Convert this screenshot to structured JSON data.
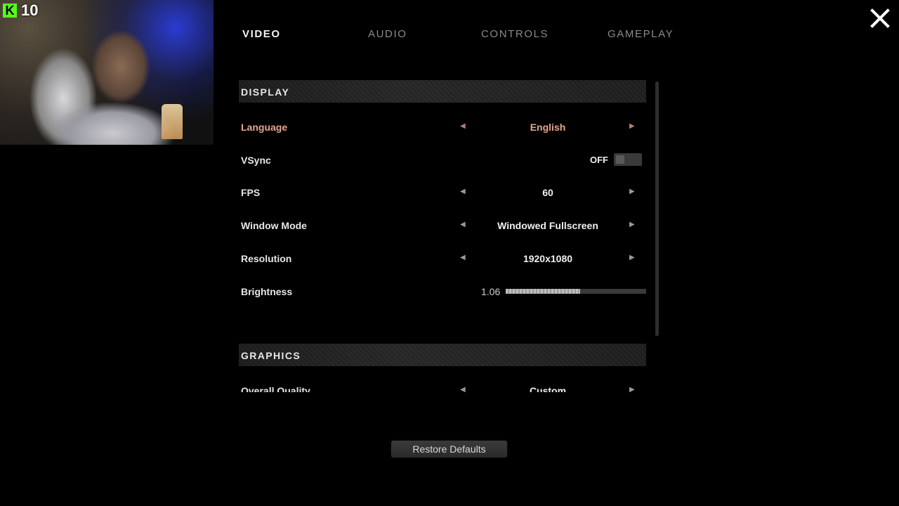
{
  "overlay": {
    "kick_logo": "K",
    "viewer_count": "10"
  },
  "tabs": [
    {
      "label": "VIDEO",
      "active": true
    },
    {
      "label": "AUDIO",
      "active": false
    },
    {
      "label": "CONTROLS",
      "active": false
    },
    {
      "label": "GAMEPLAY",
      "active": false
    }
  ],
  "display": {
    "title": "DISPLAY",
    "language": {
      "label": "Language",
      "value": "English"
    },
    "vsync": {
      "label": "VSync",
      "value": "OFF"
    },
    "fps": {
      "label": "FPS",
      "value": "60"
    },
    "window_mode": {
      "label": "Window Mode",
      "value": "Windowed Fullscreen"
    },
    "resolution": {
      "label": "Resolution",
      "value": "1920x1080"
    },
    "brightness": {
      "label": "Brightness",
      "value": "1.06",
      "fill_fraction": 0.53
    }
  },
  "graphics": {
    "title": "GRAPHICS",
    "overall_quality": {
      "label": "Overall Quality",
      "value": "Custom"
    }
  },
  "restore_label": "Restore Defaults",
  "icons": {
    "left_arrow": "◀",
    "right_arrow": "▶",
    "close": "close-icon"
  },
  "colors": {
    "highlight": "#e8a58a",
    "kick_green": "#53fc18"
  }
}
